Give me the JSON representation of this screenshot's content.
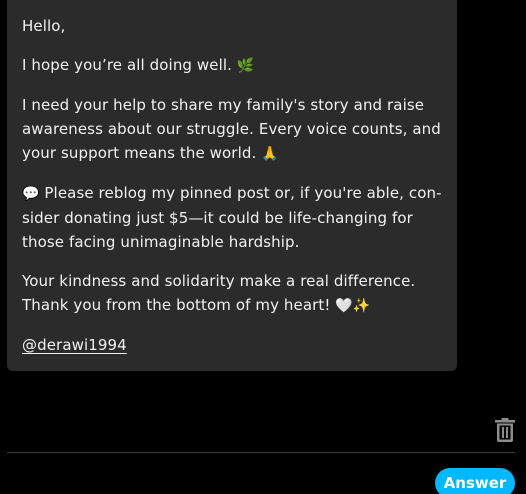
{
  "message": {
    "greeting": "Hello,",
    "line1_text": "I hope you’re all doing well. ",
    "line1_emoji": "🌿",
    "paragraph2_text": "I need your help to share my family's story and raise awareness about our struggle. Every voice counts, and your support means the world. ",
    "paragraph2_emoji": "🙏",
    "paragraph3_emoji": "💬",
    "paragraph3_text": " Please reblog my pinned post or, if you're able, con-sider donating just $5—it could be life-changing for those facing unimaginable hardship.",
    "paragraph4_text": "Your kindness and solidarity make a real difference. Thank you from the bottom of my heart! ",
    "paragraph4_emoji": "🤍✨",
    "mention": "@derawi1994"
  },
  "actions": {
    "delete_icon": "trash-icon",
    "answer_label": "Answer"
  },
  "colors": {
    "card_background": "#2b2b2b",
    "page_background": "#000000",
    "accent": "#00b8ff"
  }
}
